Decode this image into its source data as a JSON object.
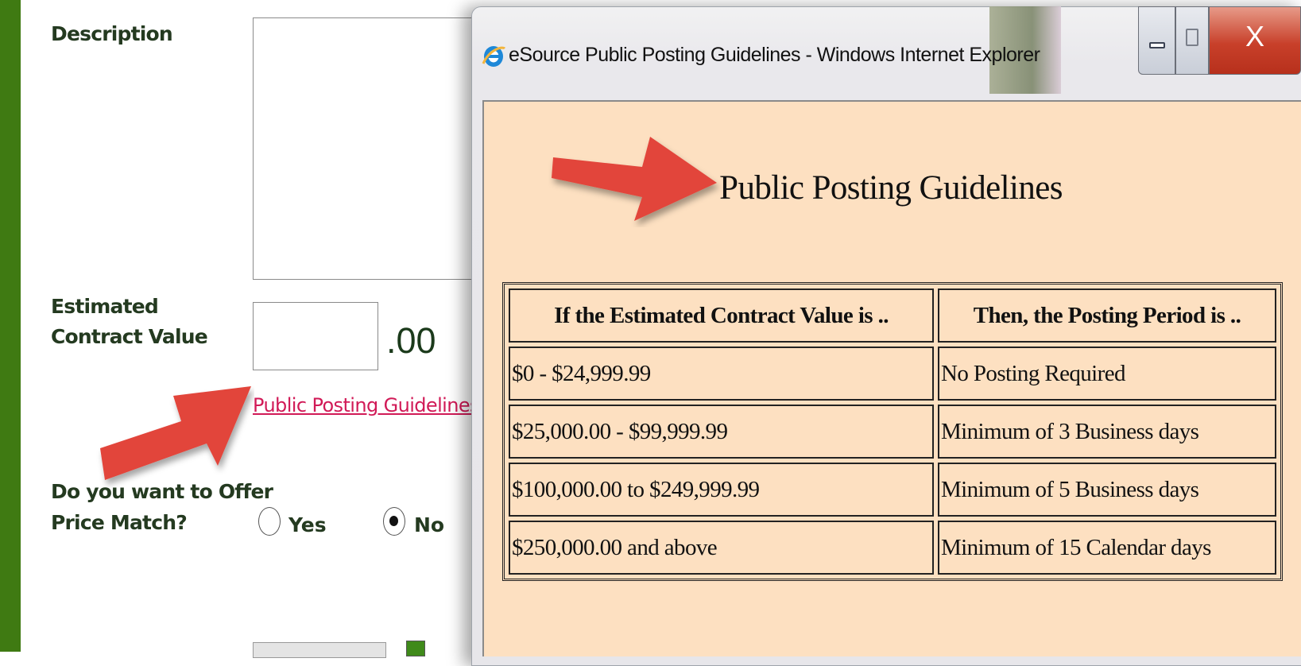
{
  "form": {
    "description_label": "Description",
    "estimated_label_line1": "Estimated",
    "estimated_label_line2": "Contract Value",
    "cents": ".00",
    "guidelines_link": "Public Posting Guidelines",
    "price_match_line1": "Do you want to Offer",
    "price_match_line2": "Price Match?",
    "radio_yes": "Yes",
    "radio_no": "No",
    "price_match_selected": "No"
  },
  "popup": {
    "title": "eSource Public Posting Guidelines - Windows Internet Explorer",
    "close_glyph": "X",
    "heading": "Public Posting Guidelines",
    "table": {
      "headers": [
        "If the Estimated Contract Value is ..",
        "Then, the Posting Period is .."
      ],
      "rows": [
        [
          "$0 - $24,999.99",
          "No Posting Required"
        ],
        [
          "$25,000.00 - $99,999.99",
          "Minimum of 3 Business days"
        ],
        [
          "$100,000.00 to $249,999.99",
          "Minimum of 5 Business days"
        ],
        [
          "$250,000.00 and above",
          "Minimum of 15 Calendar days"
        ]
      ]
    }
  },
  "colors": {
    "sidebar_green": "#3f7a12",
    "link_pink": "#d11a57",
    "popup_bg": "#fde0c1",
    "arrow_red": "#e2453b"
  },
  "icons": {
    "browser": "ie-icon",
    "minimize": "minimize-icon",
    "maximize": "maximize-icon",
    "close": "close-icon"
  }
}
